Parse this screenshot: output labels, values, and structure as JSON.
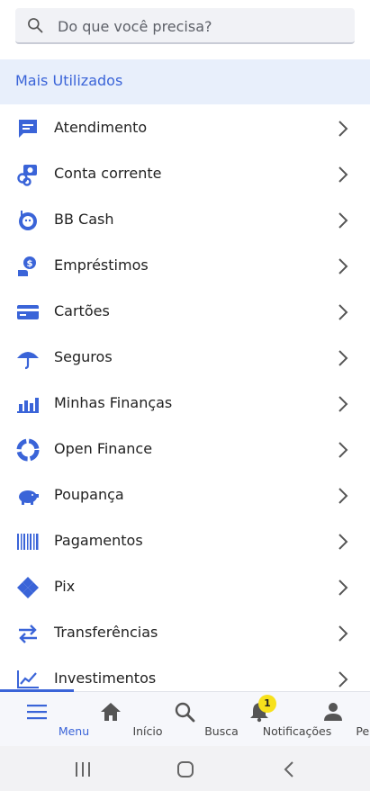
{
  "search": {
    "placeholder": "Do que você precisa?",
    "value": ""
  },
  "section": {
    "title": "Mais Utilizados"
  },
  "menu_items": [
    {
      "label": "Atendimento",
      "icon": "chat-icon"
    },
    {
      "label": "Conta corrente",
      "icon": "coins-icon"
    },
    {
      "label": "BB Cash",
      "icon": "bb-cash-icon"
    },
    {
      "label": "Empréstimos",
      "icon": "loan-icon"
    },
    {
      "label": "Cartões",
      "icon": "card-icon"
    },
    {
      "label": "Seguros",
      "icon": "umbrella-icon"
    },
    {
      "label": "Minhas Finanças",
      "icon": "bar-chart-icon"
    },
    {
      "label": "Open Finance",
      "icon": "open-finance-icon"
    },
    {
      "label": "Poupança",
      "icon": "piggy-bank-icon"
    },
    {
      "label": "Pagamentos",
      "icon": "barcode-icon"
    },
    {
      "label": "Pix",
      "icon": "pix-icon"
    },
    {
      "label": "Transferências",
      "icon": "transfer-icon"
    },
    {
      "label": "Investimentos",
      "icon": "line-chart-icon"
    }
  ],
  "bottom_nav": {
    "items": [
      {
        "label": "Menu",
        "icon": "menu-icon",
        "active": true
      },
      {
        "label": "Início",
        "icon": "home-icon"
      },
      {
        "label": "Busca",
        "icon": "search-icon"
      },
      {
        "label": "Notificações",
        "icon": "bell-icon",
        "badge": "1"
      },
      {
        "label": "Perfil",
        "icon": "person-icon"
      }
    ]
  },
  "colors": {
    "accent": "#3a64d8",
    "header_bg": "#e8effb",
    "badge": "#f7e11c"
  }
}
